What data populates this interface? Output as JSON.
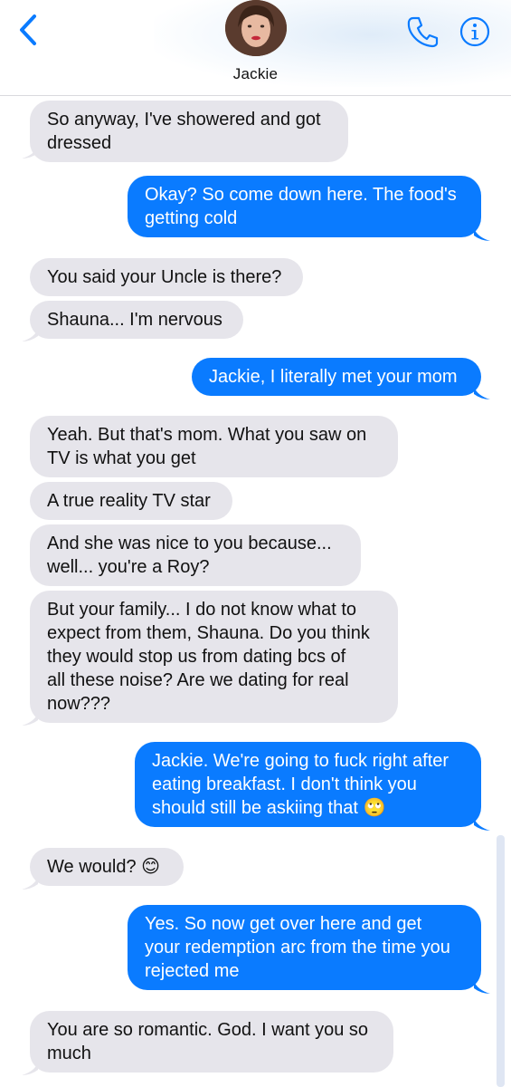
{
  "header": {
    "contact_name": "Jackie",
    "icons": {
      "back": "chevron-left-icon",
      "phone": "phone-icon",
      "info": "info-icon"
    }
  },
  "colors": {
    "accent": "#0a7bff",
    "incoming": "#e6e5eb"
  },
  "messages": [
    {
      "from": "them",
      "text": "So anyway, I've showered and got\ndressed"
    },
    {
      "from": "me",
      "text": "Okay? So come down here. The food's\ngetting cold"
    },
    {
      "from": "them",
      "text": "You said your Uncle is there?"
    },
    {
      "from": "them",
      "text": "Shauna... I'm nervous"
    },
    {
      "from": "me",
      "text": "Jackie, I literally met your mom"
    },
    {
      "from": "them",
      "text": "Yeah. But that's mom. What you saw on\nTV is what you get"
    },
    {
      "from": "them",
      "text": "A true reality TV star"
    },
    {
      "from": "them",
      "text": "And she was nice to you because...\nwell... you're a Roy?"
    },
    {
      "from": "them",
      "text": "But your family... I do not know what to\nexpect from them, Shauna. Do you think\nthey would stop us from dating bcs of\nall these noise? Are we dating for real\nnow???"
    },
    {
      "from": "me",
      "text": "Jackie. We're going to fuck right after\neating breakfast. I don't think you\nshould still be askiing that 🙄"
    },
    {
      "from": "them",
      "text": "We would? 😊"
    },
    {
      "from": "me",
      "text": "Yes. So now get over here and get\nyour redemption arc from the time you\nrejected me"
    },
    {
      "from": "them",
      "text": "You are so romantic. God. I want you so\nmuch"
    }
  ]
}
